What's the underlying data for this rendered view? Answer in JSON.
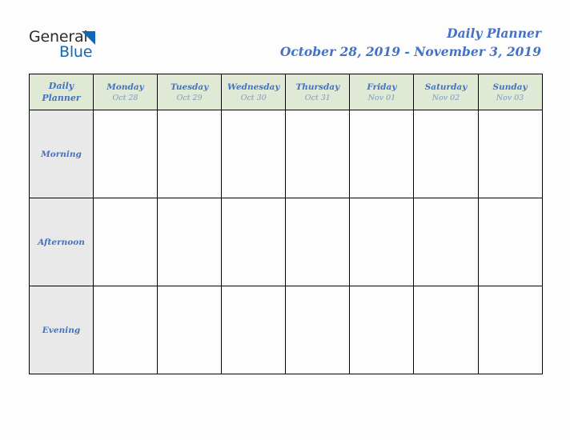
{
  "brand": {
    "name_part1": "General",
    "name_part2": "Blue",
    "triangle_color": "#1368b3",
    "text_color": "#2b2b2b"
  },
  "header": {
    "title": "Daily Planner",
    "date_range": "October 28, 2019 - November 3, 2019",
    "accent_color": "#4472c4"
  },
  "planner": {
    "corner_label_line1": "Daily",
    "corner_label_line2": "Planner",
    "header_bg": "#dfe9d3",
    "row_label_bg": "#e9e9e9",
    "columns": [
      {
        "day": "Monday",
        "date": "Oct 28"
      },
      {
        "day": "Tuesday",
        "date": "Oct 29"
      },
      {
        "day": "Wednesday",
        "date": "Oct 30"
      },
      {
        "day": "Thursday",
        "date": "Oct 31"
      },
      {
        "day": "Friday",
        "date": "Nov 01"
      },
      {
        "day": "Saturday",
        "date": "Nov 02"
      },
      {
        "day": "Sunday",
        "date": "Nov 03"
      }
    ],
    "rows": [
      {
        "label": "Morning",
        "cells": [
          "",
          "",
          "",
          "",
          "",
          "",
          ""
        ]
      },
      {
        "label": "Afternoon",
        "cells": [
          "",
          "",
          "",
          "",
          "",
          "",
          ""
        ]
      },
      {
        "label": "Evening",
        "cells": [
          "",
          "",
          "",
          "",
          "",
          "",
          ""
        ]
      }
    ]
  }
}
